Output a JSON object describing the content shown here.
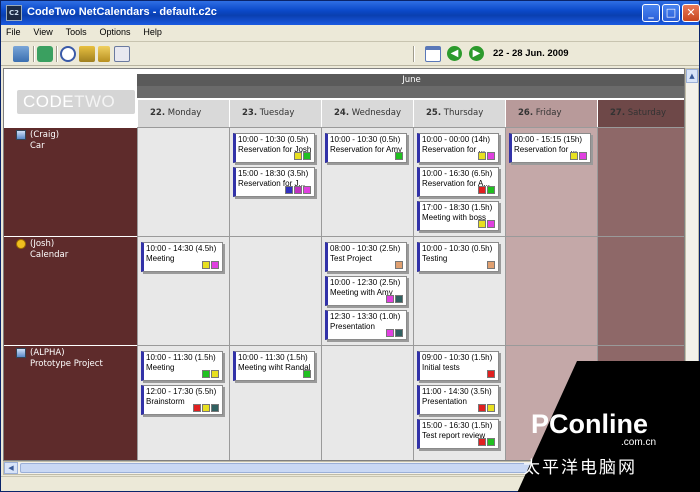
{
  "window": {
    "title": "CodeTwo NetCalendars - default.c2c",
    "app_icon": "C2"
  },
  "titlebar_buttons": {
    "minimize": "_",
    "maximize": "□",
    "close": "✕"
  },
  "menu": [
    "File",
    "View",
    "Tools",
    "Options",
    "Help"
  ],
  "toolbar": {
    "date_range": "22 - 28 Jun. 2009"
  },
  "logo": {
    "text": "CODE",
    "text2": "TWO"
  },
  "month": "June",
  "days": [
    {
      "num": "22.",
      "name": "Monday"
    },
    {
      "num": "23.",
      "name": "Tuesday"
    },
    {
      "num": "24.",
      "name": "Wednesday"
    },
    {
      "num": "25.",
      "name": "Thursday"
    },
    {
      "num": "26.",
      "name": "Friday"
    },
    {
      "num": "27.",
      "name": "Saturday"
    }
  ],
  "resources": [
    {
      "name": "(Craig)",
      "sub": "Car",
      "icon": "person-icon"
    },
    {
      "name": "(Josh)",
      "sub": "Calendar",
      "icon": "calendar-icon"
    },
    {
      "name": "(ALPHA)",
      "sub": "Prototype Project",
      "icon": "person-icon"
    }
  ],
  "events": [
    {
      "row": 0,
      "day": 1,
      "slot": 0,
      "time": "10:00 - 10:30 (0.5h)",
      "title": "Reservation for Josh",
      "swatches": [
        "#e8e020",
        "#20c020"
      ]
    },
    {
      "row": 0,
      "day": 1,
      "slot": 1,
      "time": "15:00 - 18:30 (3.5h)",
      "title": "Reservation for J...",
      "swatches": [
        "#3030c0",
        "#c030c0",
        "#e040e0"
      ]
    },
    {
      "row": 0,
      "day": 2,
      "slot": 0,
      "time": "10:00 - 10:30 (0.5h)",
      "title": "Reservation for Amy",
      "swatches": [
        "#20c020"
      ]
    },
    {
      "row": 0,
      "day": 3,
      "slot": 0,
      "time": "10:00 - 00:00 (14h)",
      "title": "Reservation for ...",
      "swatches": [
        "#e8e020",
        "#e040e0"
      ]
    },
    {
      "row": 0,
      "day": 3,
      "slot": 1,
      "time": "10:00 - 16:30 (6.5h)",
      "title": "Reservation for A...",
      "swatches": [
        "#e02020",
        "#20c020"
      ]
    },
    {
      "row": 0,
      "day": 3,
      "slot": 2,
      "time": "17:00 - 18:30 (1.5h)",
      "title": "Meeting with boss",
      "swatches": [
        "#e8e020",
        "#e040e0"
      ]
    },
    {
      "row": 0,
      "day": 4,
      "slot": 0,
      "time": "00:00 - 15:15 (15h)",
      "title": "Reservation for ...",
      "swatches": [
        "#e8e020",
        "#e040e0"
      ]
    },
    {
      "row": 1,
      "day": 0,
      "slot": 0,
      "time": "10:00 - 14:30 (4.5h)",
      "title": "Meeting",
      "swatches": [
        "#e8e020",
        "#e040e0"
      ]
    },
    {
      "row": 1,
      "day": 2,
      "slot": 0,
      "time": "08:00 - 10:30 (2.5h)",
      "title": "Test Project",
      "swatches": [
        "#e0a070"
      ]
    },
    {
      "row": 1,
      "day": 2,
      "slot": 1,
      "time": "10:00 - 12:30 (2.5h)",
      "title": "Meeting with Amy",
      "swatches": [
        "#e040e0",
        "#306060"
      ]
    },
    {
      "row": 1,
      "day": 2,
      "slot": 2,
      "time": "12:30 - 13:30 (1.0h)",
      "title": "Presentation",
      "swatches": [
        "#e040e0",
        "#306060"
      ]
    },
    {
      "row": 1,
      "day": 3,
      "slot": 0,
      "time": "10:00 - 10:30 (0.5h)",
      "title": "Testing",
      "swatches": [
        "#e0a070"
      ]
    },
    {
      "row": 2,
      "day": 0,
      "slot": 0,
      "time": "10:00 - 11:30 (1.5h)",
      "title": "Meeting",
      "swatches": [
        "#20c020",
        "#e8e020"
      ]
    },
    {
      "row": 2,
      "day": 0,
      "slot": 1,
      "time": "12:00 - 17:30 (5.5h)",
      "title": "Brainstorm",
      "swatches": [
        "#e02020",
        "#e8e020",
        "#306060"
      ]
    },
    {
      "row": 2,
      "day": 1,
      "slot": 0,
      "time": "10:00 - 11:30 (1.5h)",
      "title": "Meeting wiht Randal",
      "swatches": [
        "#20c020"
      ]
    },
    {
      "row": 2,
      "day": 3,
      "slot": 0,
      "time": "09:00 - 10:30 (1.5h)",
      "title": "Initial tests",
      "swatches": [
        "#e02020"
      ]
    },
    {
      "row": 2,
      "day": 3,
      "slot": 1,
      "time": "11:00 - 14:30 (3.5h)",
      "title": "Presentation",
      "swatches": [
        "#e02020",
        "#e8e020"
      ]
    },
    {
      "row": 2,
      "day": 3,
      "slot": 2,
      "time": "15:00 - 16:30 (1.5h)",
      "title": "Test report review",
      "swatches": [
        "#e02020",
        "#20c020"
      ]
    }
  ],
  "watermark": {
    "brand": "PConline",
    "domain": ".com.cn",
    "cn": "太平洋电脑网"
  },
  "colors": {
    "resource": "#5e2b2b",
    "weekday": "#e8e8e8",
    "friday": "#c4a8a8",
    "saturday": "#8e6868",
    "event_bar": "#3232a8"
  }
}
